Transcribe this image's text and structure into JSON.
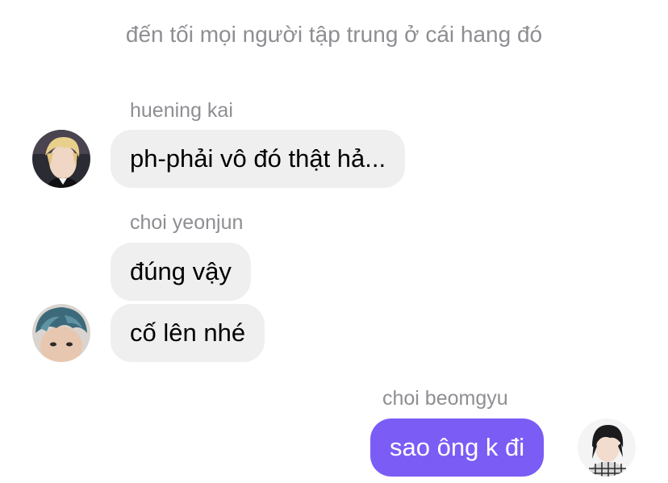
{
  "system_message": "đến tối mọi người tập trung ở cái hang đó",
  "messages": [
    {
      "sender": "huening kai",
      "direction": "incoming",
      "bubbles": [
        "ph-phải vô đó thật hả..."
      ],
      "avatar": "huening-kai-avatar"
    },
    {
      "sender": "choi yeonjun",
      "direction": "incoming",
      "bubbles": [
        "đúng vậy",
        "cố lên nhé"
      ],
      "avatar": "choi-yeonjun-avatar"
    },
    {
      "sender": "choi beomgyu",
      "direction": "outgoing",
      "bubbles": [
        "sao ông k đi"
      ],
      "avatar": "choi-beomgyu-avatar"
    }
  ],
  "colors": {
    "incoming_bubble": "#efefef",
    "outgoing_bubble": "#7b5cf5",
    "meta_text": "#8e8e93"
  }
}
